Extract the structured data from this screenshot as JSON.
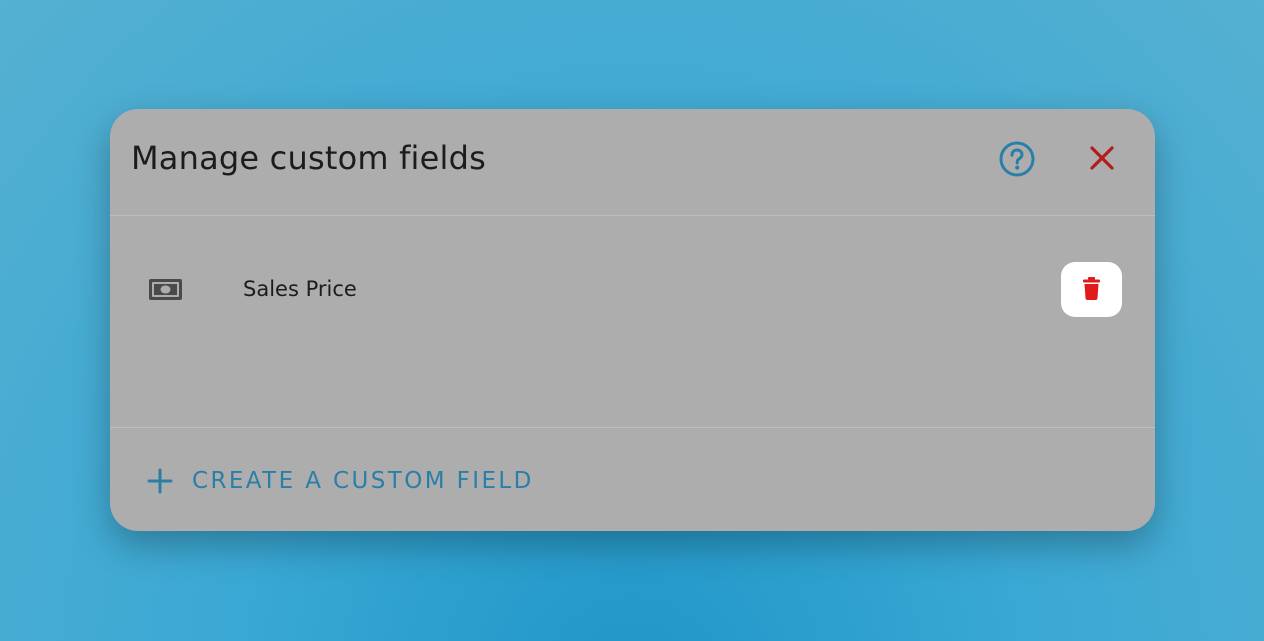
{
  "dialog": {
    "title": "Manage custom fields",
    "help_icon": "help-circle-icon",
    "close_icon": "close-icon"
  },
  "fields": [
    {
      "label": "Sales Price",
      "icon": "money-icon",
      "delete_icon": "trash-icon"
    }
  ],
  "footer": {
    "create_label": "CREATE A CUSTOM FIELD",
    "create_icon": "plus-icon"
  },
  "colors": {
    "background": "#2a9ed0",
    "dialog": "#adadad",
    "accent": "#2a7fa8",
    "close": "#b51c1c",
    "delete": "#e01b1b"
  }
}
